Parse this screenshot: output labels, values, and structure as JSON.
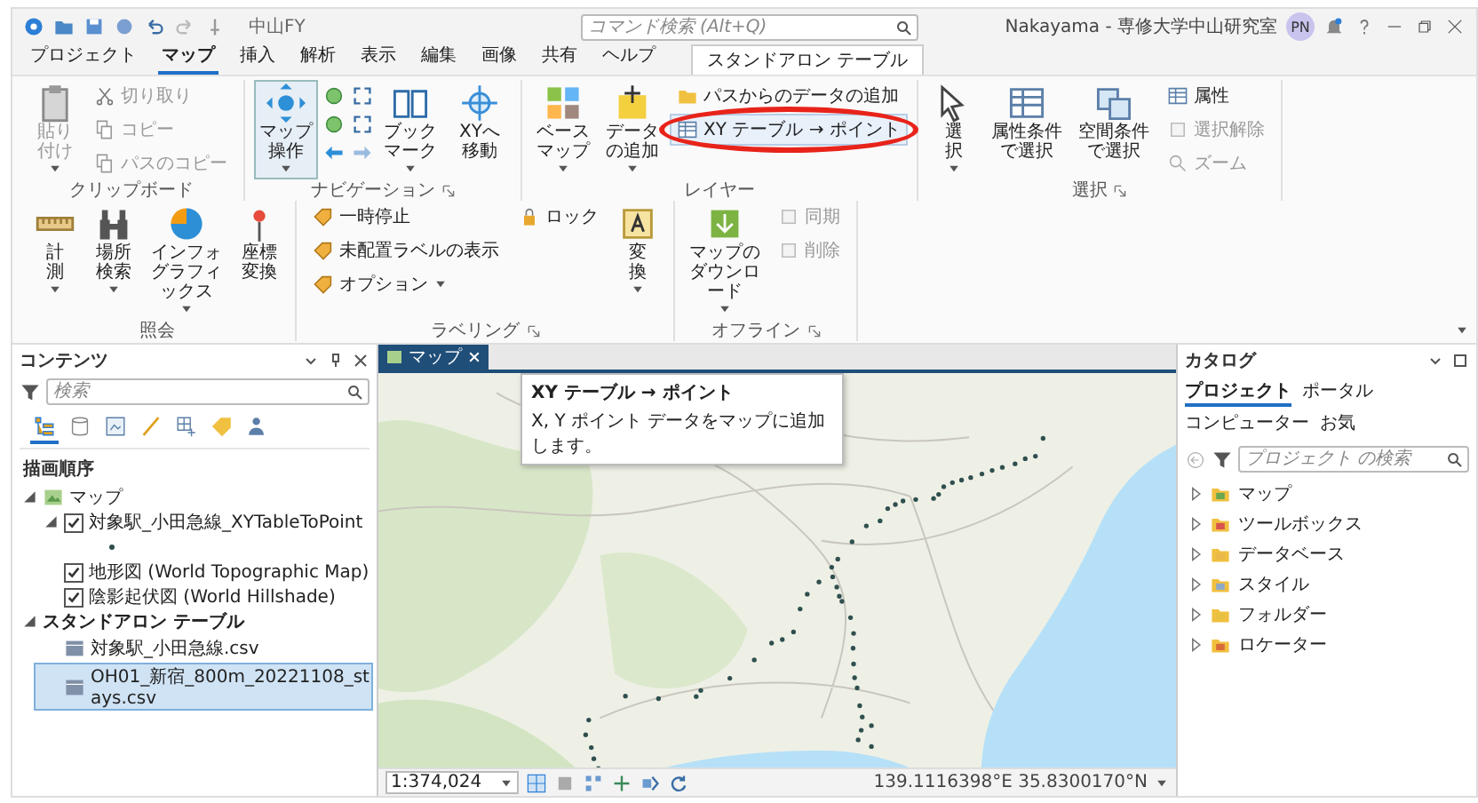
{
  "title_bar": {
    "quick_access": "中山FY",
    "search": {
      "placeholder": "コマンド検索 (Alt+Q)"
    },
    "user": "Nakayama - 専修大学中山研究室",
    "avatar": "PN"
  },
  "tabs": [
    {
      "label": "プロジェクト",
      "selected": false,
      "kind": "normal"
    },
    {
      "label": "マップ",
      "selected": true,
      "kind": "normal"
    },
    {
      "label": "挿入",
      "selected": false,
      "kind": "normal"
    },
    {
      "label": "解析",
      "selected": false,
      "kind": "normal"
    },
    {
      "label": "表示",
      "selected": false,
      "kind": "normal"
    },
    {
      "label": "編集",
      "selected": false,
      "kind": "normal"
    },
    {
      "label": "画像",
      "selected": false,
      "kind": "normal"
    },
    {
      "label": "共有",
      "selected": false,
      "kind": "normal"
    },
    {
      "label": "ヘルプ",
      "selected": false,
      "kind": "normal"
    },
    {
      "label": "スタンドアロン テーブル",
      "selected": false,
      "kind": "contextual"
    }
  ],
  "ribbon": {
    "groups": [
      {
        "name": "クリップボード",
        "launcher": false,
        "items": [
          {
            "kind": "large",
            "label": "貼り付け",
            "dropdown": true,
            "disabled": true,
            "selected": false
          },
          {
            "kind": "stack",
            "items": [
              {
                "label": "切り取り",
                "disabled": true,
                "dropdown": false,
                "highlighted": false,
                "circled": false
              },
              {
                "label": "コピー",
                "disabled": true,
                "dropdown": false,
                "highlighted": false,
                "circled": false
              },
              {
                "label": "パスのコピー",
                "disabled": true,
                "dropdown": false,
                "highlighted": false,
                "circled": false
              }
            ]
          }
        ]
      },
      {
        "name": "ナビゲーション",
        "launcher": true,
        "items": [
          {
            "kind": "large",
            "label": "マップ操作",
            "dropdown": true,
            "disabled": false,
            "selected": true
          },
          {
            "kind": "icon_grid"
          },
          {
            "kind": "large",
            "label": "ブックマーク",
            "dropdown": true,
            "disabled": false,
            "selected": false
          },
          {
            "kind": "large",
            "label": "XYへ移動",
            "dropdown": false,
            "disabled": false,
            "selected": false
          }
        ]
      },
      {
        "name": "レイヤー",
        "launcher": false,
        "items": [
          {
            "kind": "large",
            "label": "ベースマップ",
            "dropdown": true,
            "disabled": false,
            "selected": false
          },
          {
            "kind": "large",
            "label": "データの追加",
            "dropdown": true,
            "disabled": false,
            "selected": false
          },
          {
            "kind": "stack",
            "items": [
              {
                "label": "パスからのデータの追加",
                "disabled": false,
                "dropdown": false,
                "highlighted": false,
                "circled": false
              },
              {
                "label": "XY テーブル → ポイント",
                "disabled": false,
                "dropdown": false,
                "highlighted": true,
                "circled": true
              }
            ]
          }
        ]
      },
      {
        "name": "選択",
        "launcher": true,
        "items": [
          {
            "kind": "large",
            "label": "選択",
            "dropdown": true,
            "disabled": false,
            "selected": false
          },
          {
            "kind": "large",
            "label": "属性条件で選択",
            "dropdown": false,
            "disabled": false,
            "selected": false
          },
          {
            "kind": "large",
            "label": "空間条件で選択",
            "dropdown": false,
            "disabled": false,
            "selected": false
          },
          {
            "kind": "stack",
            "items": [
              {
                "label": "属性",
                "disabled": false,
                "dropdown": false,
                "highlighted": false,
                "circled": false
              },
              {
                "label": "選択解除",
                "disabled": true,
                "dropdown": false,
                "highlighted": false,
                "circled": false
              },
              {
                "label": "ズーム",
                "disabled": true,
                "dropdown": false,
                "highlighted": false,
                "circled": false
              }
            ]
          }
        ]
      },
      {
        "name": "照会",
        "launcher": false,
        "items": [
          {
            "kind": "large",
            "label": "計測",
            "dropdown": true,
            "disabled": false,
            "selected": false
          },
          {
            "kind": "large",
            "label": "場所検索",
            "dropdown": true,
            "disabled": false,
            "selected": false
          },
          {
            "kind": "large",
            "label": "インフォグラフィックス",
            "dropdown": true,
            "disabled": false,
            "selected": false
          },
          {
            "kind": "large",
            "label": "座標変換",
            "dropdown": false,
            "disabled": false,
            "selected": false
          }
        ]
      },
      {
        "name": "ラベリング",
        "launcher": true,
        "items": [
          {
            "kind": "stack",
            "items": [
              {
                "label": "一時停止",
                "disabled": false,
                "dropdown": false,
                "highlighted": false,
                "circled": false
              },
              {
                "label": "未配置ラベルの表示",
                "disabled": false,
                "dropdown": false,
                "highlighted": false,
                "circled": false
              },
              {
                "label": "オプション",
                "disabled": false,
                "dropdown": true,
                "highlighted": false,
                "circled": false
              }
            ]
          },
          {
            "kind": "stack",
            "items": [
              {
                "label": "ロック",
                "disabled": false,
                "dropdown": false,
                "highlighted": false,
                "circled": false
              }
            ]
          },
          {
            "kind": "large",
            "label": "変換",
            "dropdown": true,
            "disabled": false,
            "selected": false
          }
        ]
      },
      {
        "name": "オフライン",
        "launcher": true,
        "items": [
          {
            "kind": "large",
            "label": "マップのダウンロード",
            "dropdown": true,
            "disabled": false,
            "selected": false
          },
          {
            "kind": "stack",
            "items": [
              {
                "label": "同期",
                "disabled": true,
                "dropdown": false,
                "highlighted": false,
                "circled": false
              },
              {
                "label": "削除",
                "disabled": true,
                "dropdown": false,
                "highlighted": false,
                "circled": false
              }
            ]
          }
        ]
      }
    ]
  },
  "contents": {
    "title": "コンテンツ",
    "search": {
      "placeholder": "検索"
    },
    "view_buttons": [
      {
        "selected": true
      },
      {
        "selected": false
      },
      {
        "selected": false
      },
      {
        "selected": false
      },
      {
        "selected": false
      },
      {
        "selected": false
      },
      {
        "selected": false
      }
    ],
    "section": "描画順序",
    "tree": [
      {
        "label": "マップ",
        "kind": "map",
        "expanded": true,
        "children": [
          {
            "label": "対象駅_小田急線_XYTableToPoint",
            "kind": "layer",
            "checked": true,
            "expanded": true,
            "children": [
              {
                "kind": "symbol"
              }
            ]
          },
          {
            "label": "地形図 (World Topographic Map)",
            "kind": "layer",
            "checked": true
          },
          {
            "label": "陰影起伏図 (World Hillshade)",
            "kind": "layer",
            "checked": true
          }
        ]
      },
      {
        "label": "スタンドアロン テーブル",
        "kind": "group",
        "expanded": true,
        "children": [
          {
            "label": "対象駅_小田急線.csv",
            "kind": "table",
            "selected": false
          },
          {
            "label": "OH01_新宿_800m_20221108_stays.csv",
            "kind": "table",
            "selected": true
          }
        ]
      }
    ]
  },
  "map": {
    "tab": {
      "label": "マップ",
      "selected": true
    },
    "tooltip": {
      "title": "XY テーブル → ポイント",
      "text": "X, Y ポイント データをマップに追加します。"
    },
    "status": {
      "scale": "1:374,024",
      "coordinates": "139.1116398°E 35.8300170°N"
    }
  },
  "catalog": {
    "title": "カタログ",
    "tabs": [
      {
        "label": "プロジェクト",
        "selected": true
      },
      {
        "label": "ポータル",
        "selected": false
      },
      {
        "label": "コンピューター",
        "selected": false
      },
      {
        "label": "お気",
        "selected": false
      }
    ],
    "search": {
      "placeholder": "プロジェクト の検索"
    },
    "items": [
      {
        "label": "マップ",
        "expanded": false
      },
      {
        "label": "ツールボックス",
        "expanded": false
      },
      {
        "label": "データベース",
        "expanded": false
      },
      {
        "label": "スタイル",
        "expanded": false
      },
      {
        "label": "フォルダー",
        "expanded": false
      },
      {
        "label": "ロケーター",
        "expanded": false
      }
    ]
  }
}
